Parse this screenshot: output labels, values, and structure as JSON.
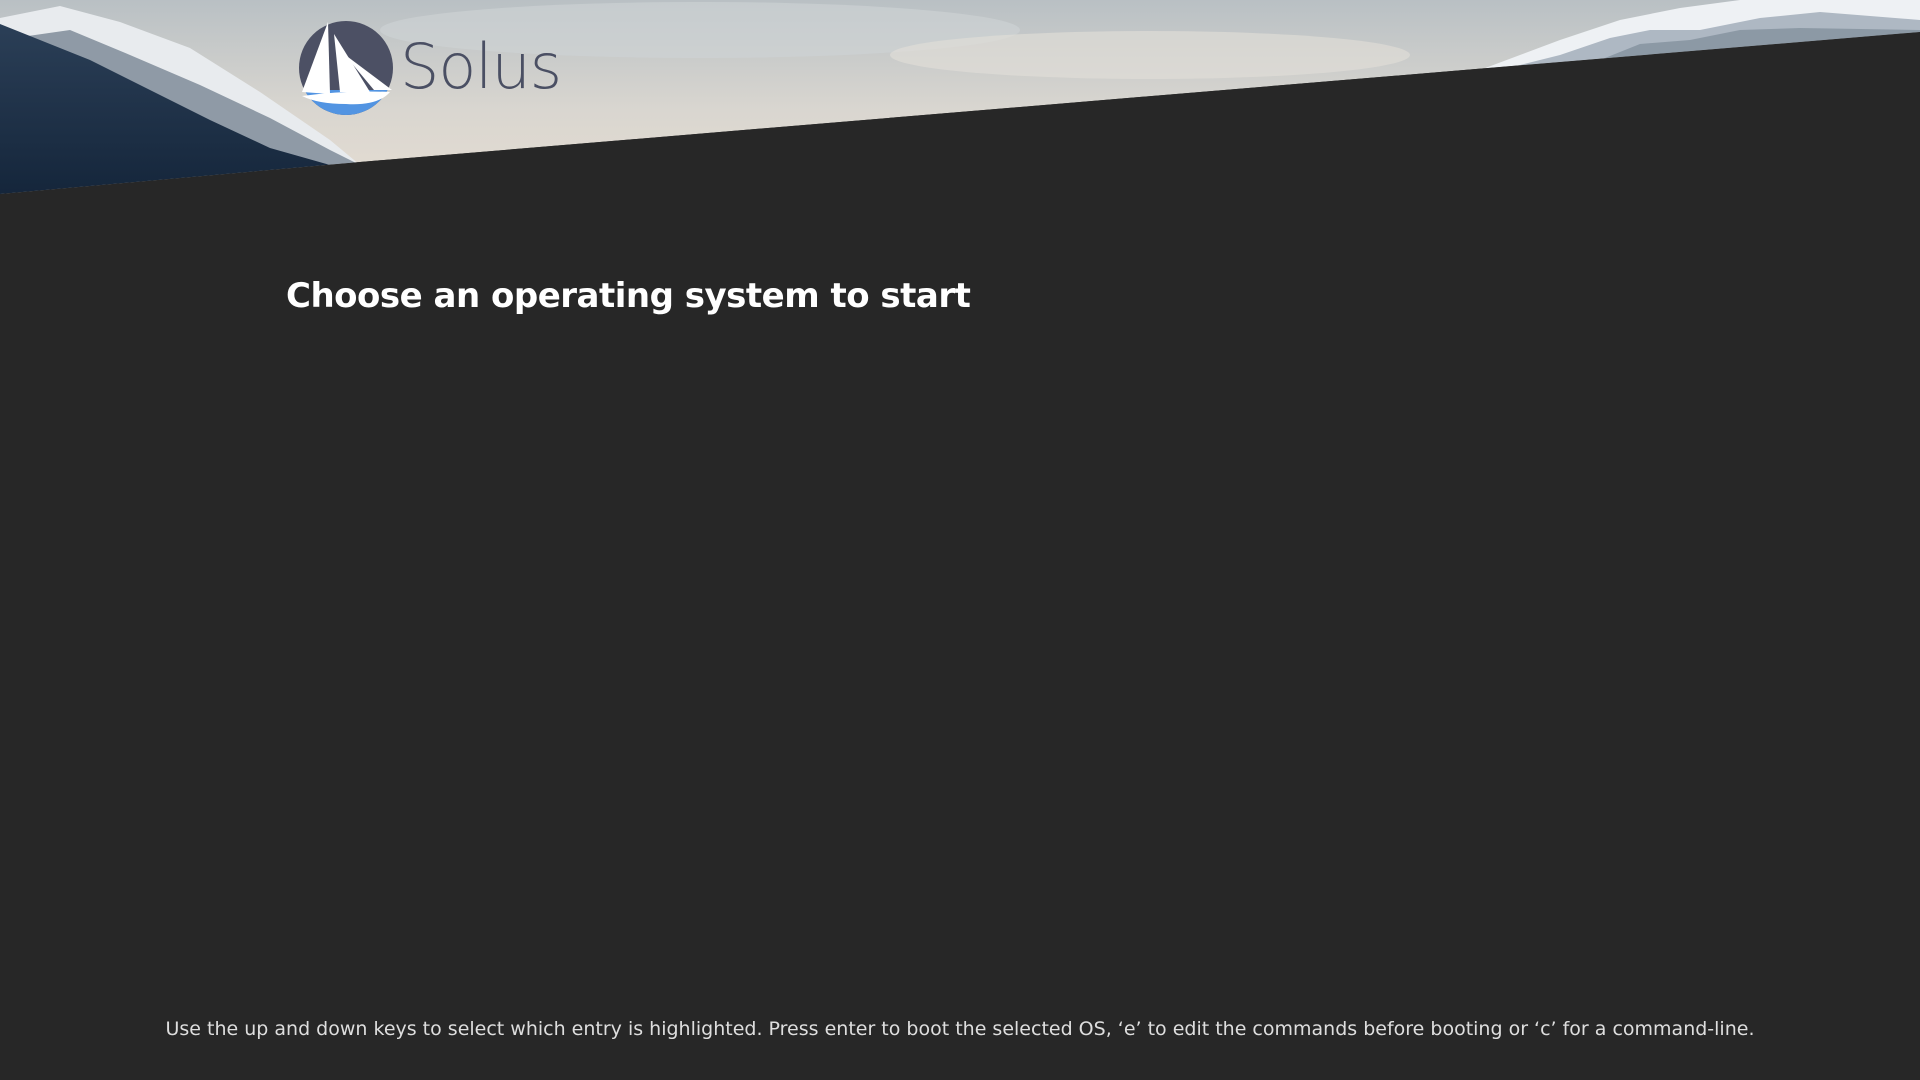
{
  "screen": {
    "background_color": "#272727"
  },
  "header": {
    "logo_icon": "solus-sailboat-icon",
    "logo_text": "Solus"
  },
  "menu": {
    "title": "Choose an operating system to start",
    "entries": []
  },
  "footer": {
    "help_text": "Use the up and down keys to select which entry is highlighted. Press enter to boot the selected OS, ‘e’ to edit the commands before booting or ‘c’ for a command-line."
  }
}
